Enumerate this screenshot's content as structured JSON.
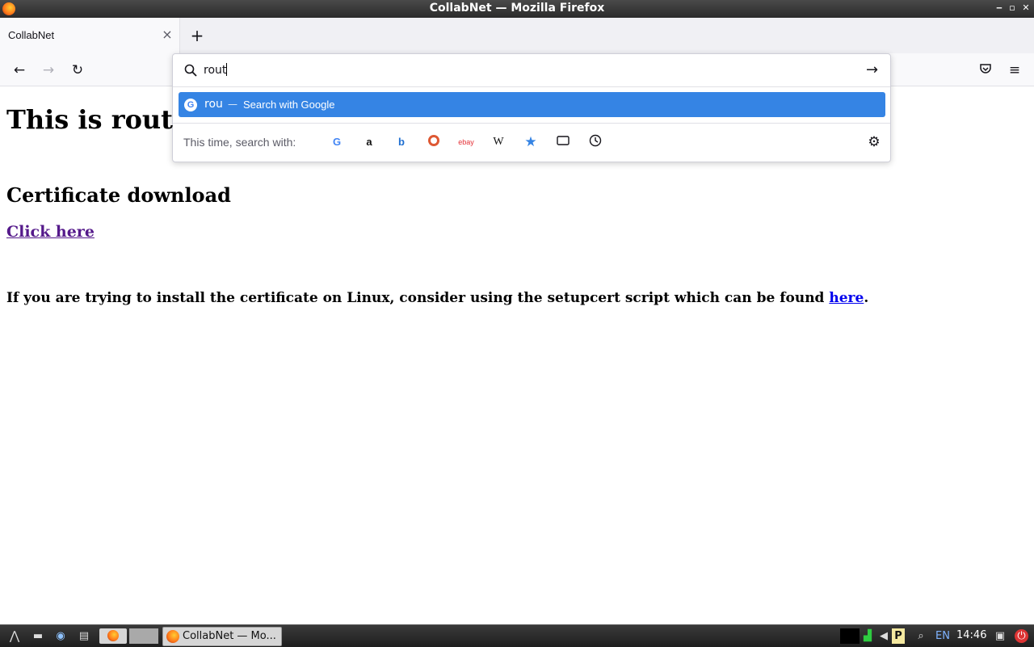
{
  "window": {
    "title": "CollabNet — Mozilla Firefox"
  },
  "tabs": [
    {
      "label": "CollabNet"
    }
  ],
  "urlbar": {
    "value": "rout",
    "suggestion": {
      "query": "rou",
      "separator": "—",
      "action": "Search with Google"
    },
    "one_off_label": "This time, search with:",
    "engines": [
      "google-icon",
      "amazon-icon",
      "bing-icon",
      "duckduckgo-icon",
      "ebay-icon",
      "wikipedia-icon",
      "bookmarks-icon",
      "tabs-icon",
      "history-icon"
    ]
  },
  "page": {
    "heading": "This is rout",
    "section_heading": "Certificate download",
    "download_link": "Click here",
    "linux_note_prefix": "If you are trying to install the certificate on Linux, consider using the setupcert script which can be found ",
    "linux_note_link": "here",
    "linux_note_suffix": "."
  },
  "taskbar": {
    "task_label": "CollabNet — Mo...",
    "language": "EN",
    "clock": "14:46"
  }
}
